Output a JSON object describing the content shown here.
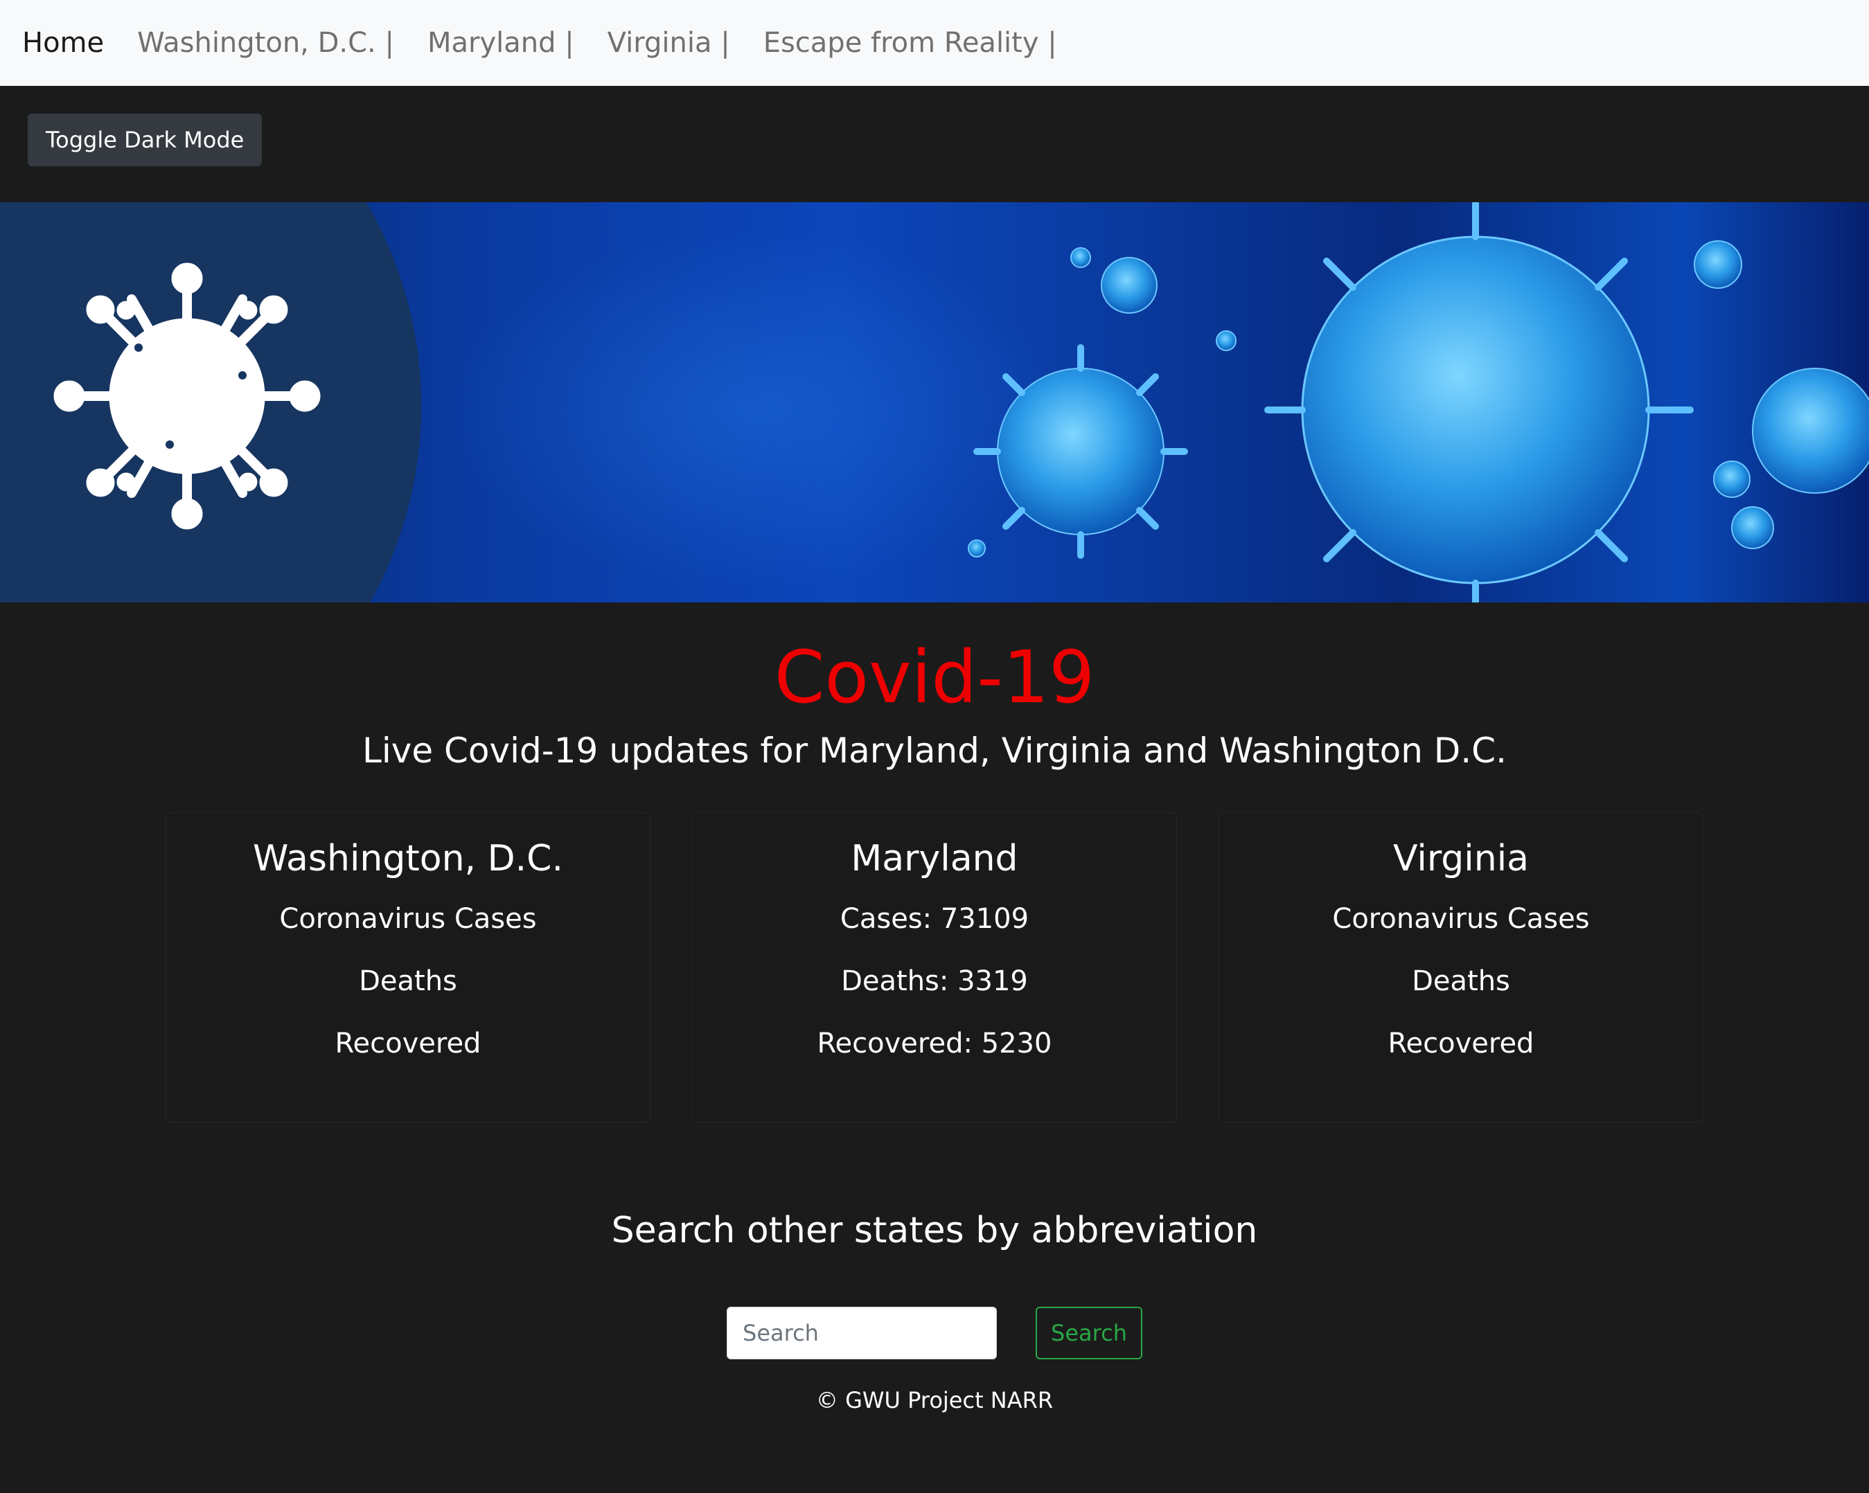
{
  "nav": {
    "items": [
      {
        "label": "Home",
        "active": true
      },
      {
        "label": "Washington, D.C. |"
      },
      {
        "label": "Maryland |"
      },
      {
        "label": "Virginia |"
      },
      {
        "label": "Escape from Reality |"
      }
    ]
  },
  "toolbar": {
    "toggle_label": "Toggle Dark Mode"
  },
  "header": {
    "title": "Covid-19",
    "subtitle": "Live Covid-19 updates for Maryland, Virginia and Washington D.C."
  },
  "cards": [
    {
      "title": "Washington, D.C.",
      "lines": [
        "Coronavirus Cases",
        "Deaths",
        "Recovered"
      ]
    },
    {
      "title": "Maryland",
      "lines": [
        "Cases: 73109",
        "Deaths: 3319",
        "Recovered: 5230"
      ]
    },
    {
      "title": "Virginia",
      "lines": [
        "Coronavirus Cases",
        "Deaths",
        "Recovered"
      ]
    }
  ],
  "search": {
    "heading": "Search other states by abbreviation",
    "placeholder": "Search",
    "button_label": "Search"
  },
  "footer": {
    "text": "© GWU Project NARR"
  },
  "colors": {
    "title": "#ee0000",
    "background": "#1b1b1b",
    "navbar": "#f8f9fa",
    "search_button": "#28a745",
    "banner_circle": "#163560"
  },
  "icons": {
    "banner": "virus-icon"
  }
}
